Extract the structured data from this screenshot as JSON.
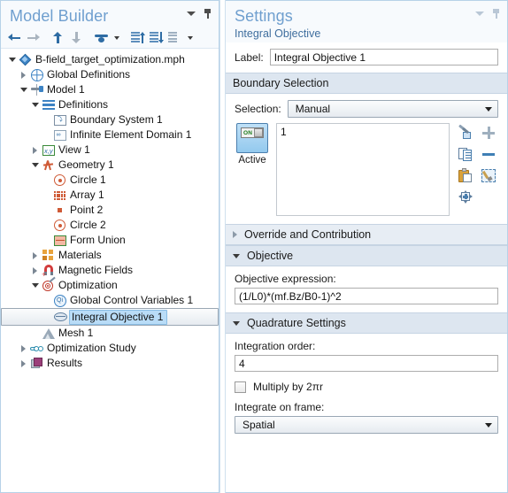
{
  "model_builder": {
    "title": "Model Builder",
    "toolbar": [
      {
        "name": "go-back-button",
        "icon": "arrow-left-icon"
      },
      {
        "name": "go-forward-button",
        "icon": "arrow-right-icon"
      },
      {
        "name": "move-up-button",
        "icon": "arrow-up-icon"
      },
      {
        "name": "move-down-button",
        "icon": "arrow-down-icon"
      },
      {
        "name": "show-button",
        "icon": "eye-icon"
      },
      {
        "name": "show-dropdown",
        "icon": "chevron-down-icon"
      },
      {
        "name": "expand-all-button",
        "icon": "list-up-icon"
      },
      {
        "name": "collapse-all-button",
        "icon": "list-down-icon"
      },
      {
        "name": "node-options-button",
        "icon": "list-icon"
      },
      {
        "name": "node-options-dropdown",
        "icon": "chevron-down-icon"
      }
    ],
    "tree": [
      {
        "label": "B-field_target_optimization.mph",
        "depth": 0,
        "twisty": "open",
        "icon": "mph-file-icon",
        "selected": false
      },
      {
        "label": "Global Definitions",
        "depth": 1,
        "twisty": "closed",
        "icon": "global-definitions-icon",
        "selected": false
      },
      {
        "label": "Model 1",
        "depth": 1,
        "twisty": "open",
        "icon": "model-icon",
        "selected": false
      },
      {
        "label": "Definitions",
        "depth": 2,
        "twisty": "open",
        "icon": "definitions-icon",
        "selected": false
      },
      {
        "label": "Boundary System 1",
        "depth": 3,
        "twisty": "none",
        "icon": "boundary-system-icon",
        "selected": false
      },
      {
        "label": "Infinite Element Domain 1",
        "depth": 3,
        "twisty": "none",
        "icon": "infinite-element-domain-icon",
        "selected": false
      },
      {
        "label": "View 1",
        "depth": 2,
        "twisty": "closed",
        "icon": "view-icon",
        "selected": false
      },
      {
        "label": "Geometry 1",
        "depth": 2,
        "twisty": "open",
        "icon": "geometry-icon",
        "selected": false
      },
      {
        "label": "Circle 1",
        "depth": 3,
        "twisty": "none",
        "icon": "circle-icon",
        "selected": false
      },
      {
        "label": "Array 1",
        "depth": 3,
        "twisty": "none",
        "icon": "array-icon",
        "selected": false
      },
      {
        "label": "Point 2",
        "depth": 3,
        "twisty": "none",
        "icon": "point-icon",
        "selected": false
      },
      {
        "label": "Circle 2",
        "depth": 3,
        "twisty": "none",
        "icon": "circle-icon",
        "selected": false
      },
      {
        "label": "Form Union",
        "depth": 3,
        "twisty": "none",
        "icon": "form-union-icon",
        "selected": false
      },
      {
        "label": "Materials",
        "depth": 2,
        "twisty": "closed",
        "icon": "materials-icon",
        "selected": false
      },
      {
        "label": "Magnetic Fields",
        "depth": 2,
        "twisty": "closed",
        "icon": "magnetic-fields-icon",
        "selected": false
      },
      {
        "label": "Optimization",
        "depth": 2,
        "twisty": "open",
        "icon": "optimization-icon",
        "selected": false
      },
      {
        "label": "Global Control Variables 1",
        "depth": 3,
        "twisty": "none",
        "icon": "global-control-variables-icon",
        "selected": false
      },
      {
        "label": "Integral Objective 1",
        "depth": 3,
        "twisty": "none",
        "icon": "integral-objective-icon",
        "selected": true
      },
      {
        "label": "Mesh 1",
        "depth": 2,
        "twisty": "none",
        "icon": "mesh-icon",
        "selected": false
      },
      {
        "label": "Optimization Study",
        "depth": 1,
        "twisty": "closed",
        "icon": "study-icon",
        "selected": false
      },
      {
        "label": "Results",
        "depth": 1,
        "twisty": "closed",
        "icon": "results-icon",
        "selected": false
      }
    ]
  },
  "settings": {
    "title": "Settings",
    "subtitle": "Integral Objective",
    "label_caption": "Label:",
    "label_value": "Integral Objective 1",
    "boundary_selection": {
      "header": "Boundary Selection",
      "selection_caption": "Selection:",
      "selection_value": "Manual",
      "active_caption": "Active",
      "active_state": "ON",
      "entities": "1",
      "tools": [
        {
          "name": "copy-to-selection-button",
          "icon": "copy-to-icon"
        },
        {
          "name": "add-to-selection-button",
          "icon": "plus-icon"
        },
        {
          "name": "copy-selection-button",
          "icon": "copy-icon"
        },
        {
          "name": "remove-from-selection-button",
          "icon": "minus-icon"
        },
        {
          "name": "paste-selection-button",
          "icon": "paste-icon"
        },
        {
          "name": "clear-selection-button",
          "icon": "clear-selection-icon"
        },
        {
          "name": "zoom-to-selection-button",
          "icon": "zoom-to-selection-icon"
        }
      ]
    },
    "override_and_contribution": {
      "header": "Override and Contribution",
      "expanded": false
    },
    "objective": {
      "header": "Objective",
      "expanded": true,
      "expression_caption": "Objective expression:",
      "expression_value": "(1/L0)*(mf.Bz/B0-1)^2"
    },
    "quadrature": {
      "header": "Quadrature Settings",
      "expanded": true,
      "integration_order_caption": "Integration order:",
      "integration_order_value": "4",
      "multiply_caption": "Multiply by 2πr",
      "multiply_checked": false,
      "frame_caption": "Integrate on frame:",
      "frame_value": "Spatial"
    }
  }
}
